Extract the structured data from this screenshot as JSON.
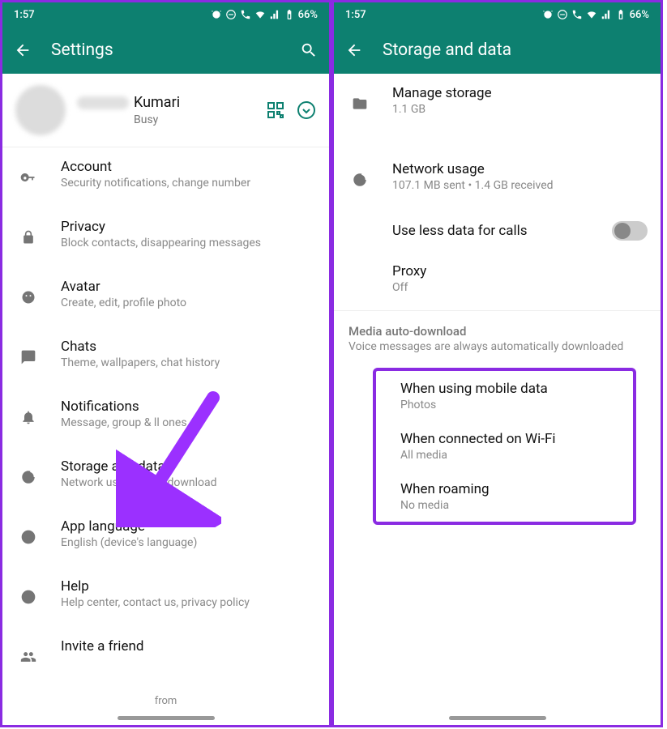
{
  "status": {
    "time": "1:57",
    "battery": "66%"
  },
  "left": {
    "appbar_title": "Settings",
    "profile": {
      "name": "Kumari",
      "status": "Busy"
    },
    "items": [
      {
        "title": "Account",
        "sub": "Security notifications, change number"
      },
      {
        "title": "Privacy",
        "sub": "Block contacts, disappearing messages"
      },
      {
        "title": "Avatar",
        "sub": "Create, edit, profile photo"
      },
      {
        "title": "Chats",
        "sub": "Theme, wallpapers, chat history"
      },
      {
        "title": "Notifications",
        "sub": "Message, group &      ll   ones"
      },
      {
        "title": "Storage and data",
        "sub": "Network usage, auto-download"
      },
      {
        "title": "App language",
        "sub": "English (device's language)"
      },
      {
        "title": "Help",
        "sub": "Help center, contact us, privacy policy"
      },
      {
        "title": "Invite a friend",
        "sub": ""
      }
    ],
    "footer": "from"
  },
  "right": {
    "appbar_title": "Storage and data",
    "manage_storage": {
      "title": "Manage storage",
      "sub": "1.1 GB"
    },
    "network_usage": {
      "title": "Network usage",
      "sub": "107.1 MB sent • 1.4 GB received"
    },
    "use_less": {
      "title": "Use less data for calls"
    },
    "proxy": {
      "title": "Proxy",
      "sub": "Off"
    },
    "media_header": "Media auto-download",
    "media_note": "Voice messages are always automatically downloaded",
    "media_items": [
      {
        "title": "When using mobile data",
        "sub": "Photos"
      },
      {
        "title": "When connected on Wi-Fi",
        "sub": "All media"
      },
      {
        "title": "When roaming",
        "sub": "No media"
      }
    ]
  }
}
